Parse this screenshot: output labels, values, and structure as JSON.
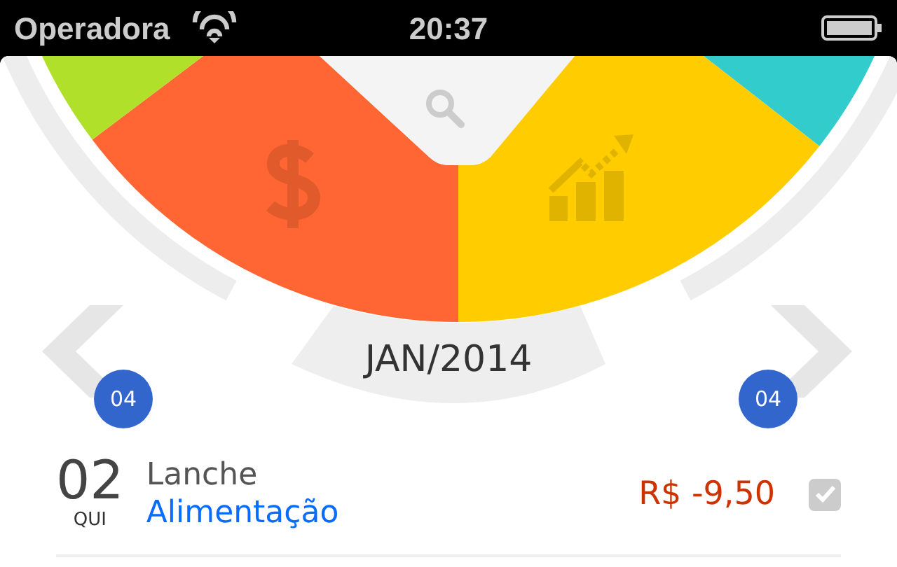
{
  "status_bar": {
    "carrier": "Operadora",
    "time": "20:37"
  },
  "wheel": {
    "segments": [
      {
        "kind": "plain",
        "color": "#33cccc"
      },
      {
        "kind": "chart",
        "color": "#ffcc00"
      },
      {
        "kind": "money",
        "color": "#ff6633"
      },
      {
        "kind": "plain",
        "color": "#b0e02a"
      }
    ],
    "search_wedge": true,
    "month": "JAN/2014",
    "previous_count": "04",
    "next_count": "04"
  },
  "transactions": [
    {
      "day": "02",
      "weekday": "QUI",
      "title": "Lanche",
      "category": "Alimentação",
      "amount": "R$ -9,50",
      "checked": true
    }
  ]
}
